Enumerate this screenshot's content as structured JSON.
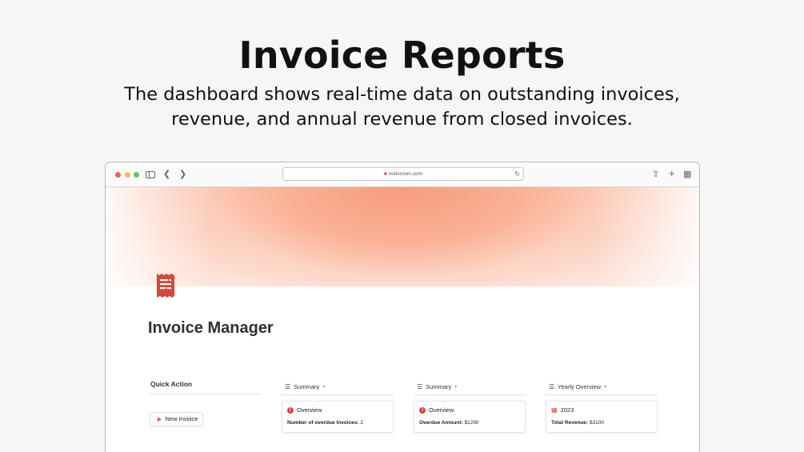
{
  "hero": {
    "title": "Invoice Reports",
    "subtitle": "The dashboard shows real-time data on outstanding invoices, revenue, and annual revenue from closed invoices."
  },
  "browser": {
    "url": "notionzen.com",
    "icons": [
      "sidebar-icon",
      "back-icon",
      "forward-icon",
      "share-icon",
      "plus-icon",
      "tabs-icon",
      "reload-icon"
    ]
  },
  "page": {
    "title": "Invoice Manager",
    "icon": "receipt-icon",
    "accent": "#d9453a"
  },
  "quick_action": {
    "label": "Quick Action",
    "button_label": "New Invoice"
  },
  "views": [
    {
      "tab_label": "Summary",
      "card_title": "Overview",
      "prop_label": "Number of overdue Invoices:",
      "prop_value": "2"
    },
    {
      "tab_label": "Summary",
      "card_title": "Overview",
      "prop_label": "Overdue Amount:",
      "prop_value": "$1290"
    },
    {
      "tab_label": "Yearly Overview",
      "card_title": "2023",
      "prop_label": "Total Revenue:",
      "prop_value": "$3100"
    }
  ]
}
